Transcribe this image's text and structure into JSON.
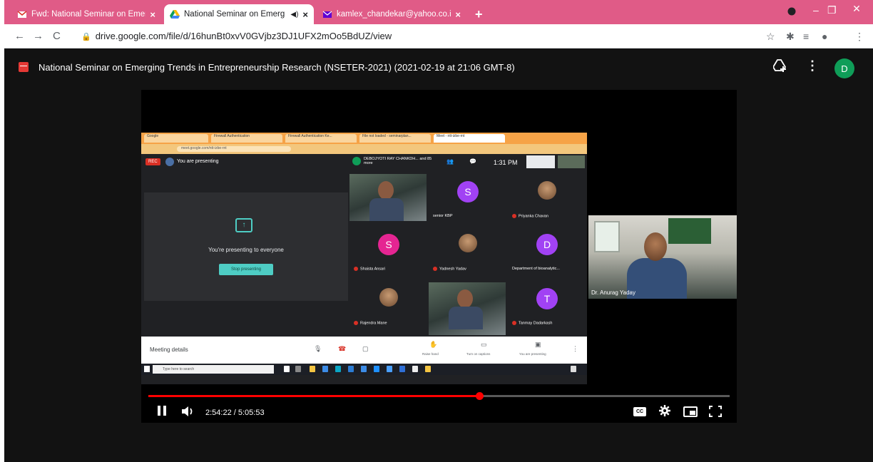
{
  "browser": {
    "tabs": [
      {
        "title": "Fwd: National Seminar on Emerg",
        "active": false
      },
      {
        "title": "National Seminar on Emerg",
        "active": true
      },
      {
        "title": "kamlex_chandekar@yahoo.co.in",
        "active": false
      }
    ],
    "url": "drive.google.com/file/d/16hunBt0xvV0GVjbz3DJ1UFX2mOo5BdUZ/view",
    "colors": {
      "tabstrip": "#e05b87",
      "accent": "#0f9d58"
    }
  },
  "drive": {
    "title": "National Seminar on Emerging Trends in Entrepreneurship Research (NSETER-2021) (2021-02-19 at 21:06 GMT-8)",
    "avatar_letter": "D"
  },
  "meeting": {
    "rec_label": "REC",
    "presenting_label": "You are presenting",
    "top_speaker": "DEBOJYOTI RAY CHANKDH... and 85 more",
    "time": "1:31 PM",
    "present_text": "You're presenting to everyone",
    "stop_button": "Stop presenting",
    "participants": [
      {
        "name": "",
        "letter": "",
        "kind": "photo"
      },
      {
        "name": "senior KBP",
        "letter": "S",
        "kind": "letter",
        "color": "#a142f4"
      },
      {
        "name": "Priyanka Chavan",
        "letter": "",
        "kind": "face"
      },
      {
        "name": "Shaista Ansari",
        "letter": "S",
        "kind": "letter",
        "color": "#e52592"
      },
      {
        "name": "Yadnesh Yadav",
        "letter": "",
        "kind": "face"
      },
      {
        "name": "Department of bioanalytic...",
        "letter": "D",
        "kind": "letter",
        "color": "#a142f4"
      },
      {
        "name": "Rajendra Mane",
        "letter": "",
        "kind": "face"
      },
      {
        "name": "",
        "letter": "",
        "kind": "photo"
      },
      {
        "name": "Tanmay Dadarkash",
        "letter": "T",
        "kind": "letter",
        "color": "#a142f4"
      }
    ],
    "details_label": "Meeting details",
    "bar_items": [
      "Raise hand",
      "Turn on captions",
      "You are presenting"
    ],
    "taskbar_search": "Type here to search",
    "speaker_name": "Dr. Anurag Yaday"
  },
  "player": {
    "current_time": "2:54:22",
    "duration": "5:05:53",
    "time_display": "2:54:22 / 5:05:53",
    "progress": 0.5693,
    "cc_label": "CC"
  }
}
